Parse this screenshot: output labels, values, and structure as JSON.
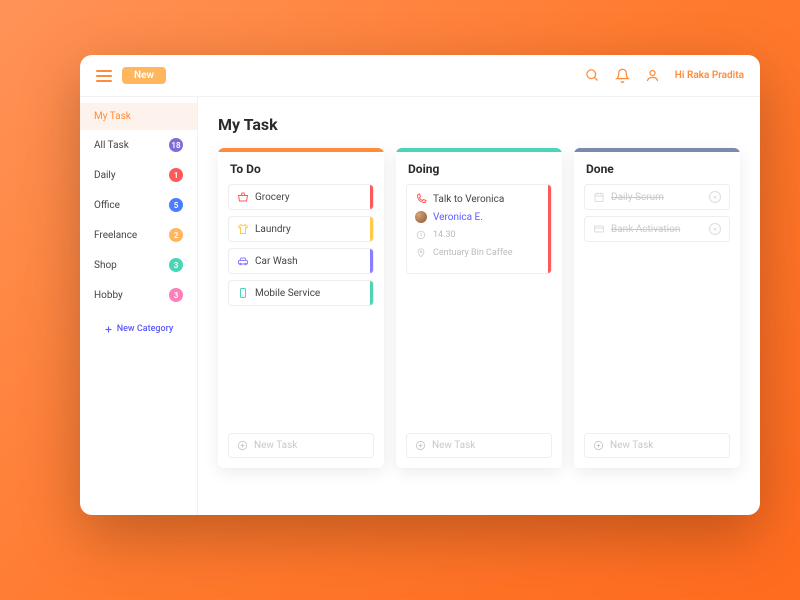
{
  "topbar": {
    "new_label": "New",
    "greeting": "Hi Raka Pradita"
  },
  "sidebar": {
    "items": [
      {
        "label": "My Task",
        "count": "",
        "active": true
      },
      {
        "label": "All Task",
        "count": "18"
      },
      {
        "label": "Daily",
        "count": "1"
      },
      {
        "label": "Office",
        "count": "5"
      },
      {
        "label": "Freelance",
        "count": "2"
      },
      {
        "label": "Shop",
        "count": "3"
      },
      {
        "label": "Hobby",
        "count": "3"
      }
    ],
    "new_category": "New Category"
  },
  "page": {
    "title": "My Task"
  },
  "columns": {
    "todo": {
      "title": "To Do",
      "tasks": [
        {
          "label": "Grocery"
        },
        {
          "label": "Laundry"
        },
        {
          "label": "Car Wash"
        },
        {
          "label": "Mobile Service"
        }
      ],
      "new_task": "New Task"
    },
    "doing": {
      "title": "Doing",
      "task": {
        "title": "Talk to Veronica",
        "person": "Veronica E.",
        "time": "14.30",
        "location": "Centuary Bin Caffee"
      },
      "new_task": "New Task"
    },
    "done": {
      "title": "Done",
      "tasks": [
        {
          "label": "Daily Scrum"
        },
        {
          "label": "Bank Activation"
        }
      ],
      "new_task": "New Task"
    }
  }
}
